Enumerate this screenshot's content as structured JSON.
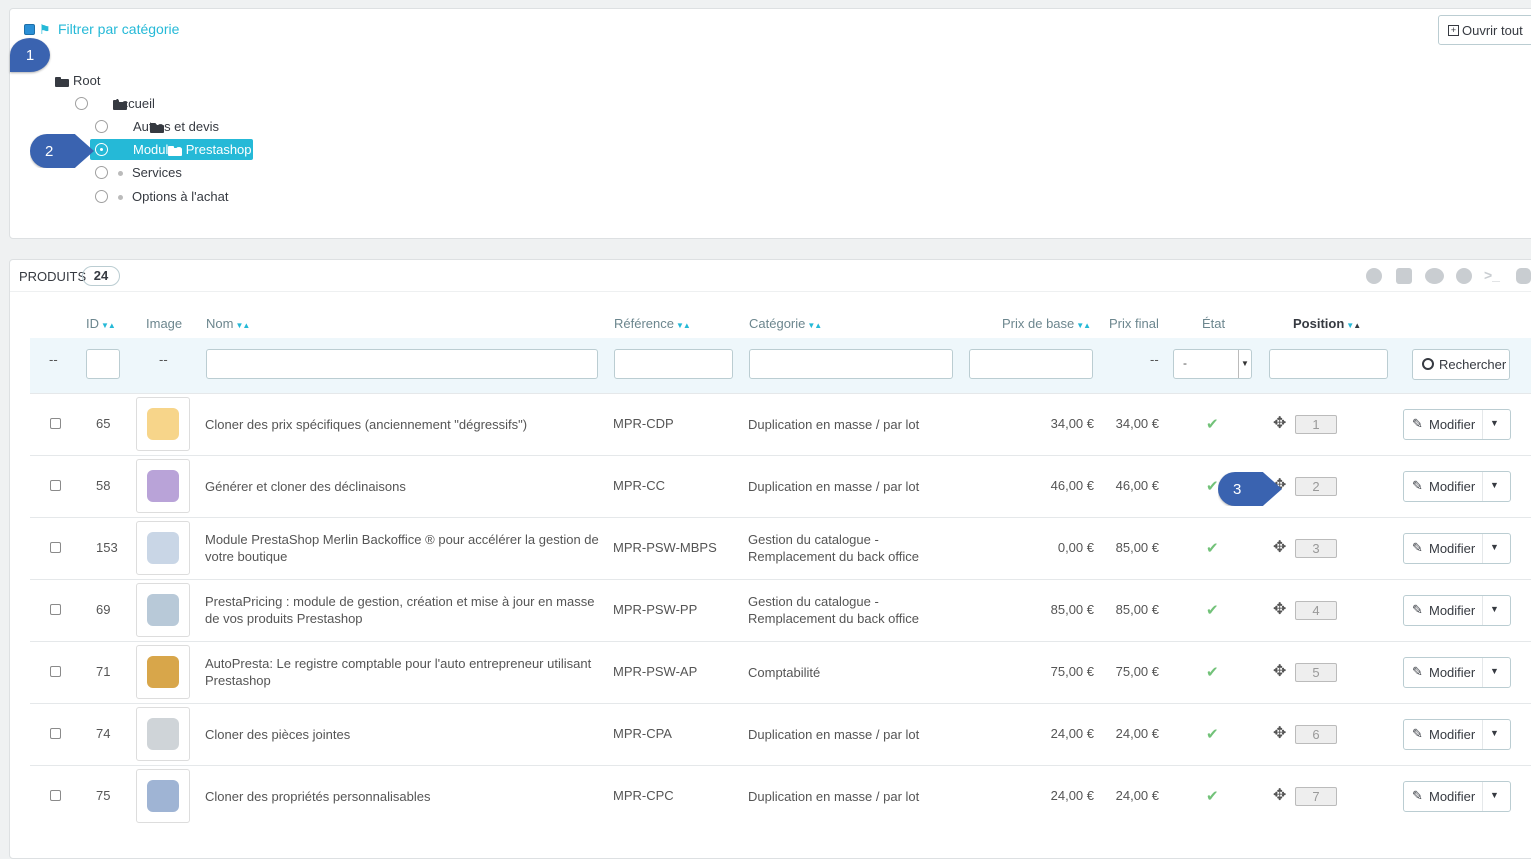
{
  "filter": {
    "title": "Filtrer par catégorie",
    "expand_all": "Ouvrir tout",
    "tree": {
      "root": "Root",
      "home": "Accueil",
      "items": [
        "Autres et devis",
        "Modules Prestashop",
        "Services",
        "Options à l'achat"
      ]
    }
  },
  "callouts": [
    "1",
    "2",
    "3"
  ],
  "products": {
    "title": "PRODUITS",
    "count": "24",
    "columns": {
      "id": "ID",
      "image": "Image",
      "name": "Nom",
      "reference": "Référence",
      "category": "Catégorie",
      "base_price": "Prix de base",
      "final_price": "Prix final",
      "status": "État",
      "position": "Position"
    },
    "filters": {
      "dash": "--",
      "status_selected": "-",
      "search_button": "Rechercher"
    },
    "edit_label": "Modifier",
    "rows": [
      {
        "id": "65",
        "name": "Cloner des prix spécifiques (anciennement \"dégressifs\")",
        "reference": "MPR-CDP",
        "category": "Duplication en masse / par lot",
        "base_price": "34,00 €",
        "final_price": "34,00 €",
        "position": "1"
      },
      {
        "id": "58",
        "name": "Générer et cloner des déclinaisons",
        "reference": "MPR-CC",
        "category": "Duplication en masse / par lot",
        "base_price": "46,00 €",
        "final_price": "46,00 €",
        "position": "2"
      },
      {
        "id": "153",
        "name": "Module PrestaShop Merlin Backoffice ® pour accélérer la gestion de votre boutique",
        "reference": "MPR-PSW-MBPS",
        "category": "Gestion du catalogue - Remplacement du back office",
        "base_price": "0,00 €",
        "final_price": "85,00 €",
        "position": "3"
      },
      {
        "id": "69",
        "name": "PrestaPricing : module de gestion, création et mise à jour en masse de vos produits Prestashop",
        "reference": "MPR-PSW-PP",
        "category": "Gestion du catalogue - Remplacement du back office",
        "base_price": "85,00 €",
        "final_price": "85,00 €",
        "position": "4"
      },
      {
        "id": "71",
        "name": "AutoPresta: Le registre comptable pour l'auto entrepreneur utilisant Prestashop",
        "reference": "MPR-PSW-AP",
        "category": "Comptabilité",
        "base_price": "75,00 €",
        "final_price": "75,00 €",
        "position": "5"
      },
      {
        "id": "74",
        "name": "Cloner des pièces jointes",
        "reference": "MPR-CPA",
        "category": "Duplication en masse / par lot",
        "base_price": "24,00 €",
        "final_price": "24,00 €",
        "position": "6"
      },
      {
        "id": "75",
        "name": "Cloner des propriétés personnalisables",
        "reference": "MPR-CPC",
        "category": "Duplication en masse / par lot",
        "base_price": "24,00 €",
        "final_price": "24,00 €",
        "position": "7"
      }
    ]
  },
  "colors": {
    "accent": "#25b9d7",
    "callout": "#3a63b0",
    "active_status": "#72c279"
  }
}
